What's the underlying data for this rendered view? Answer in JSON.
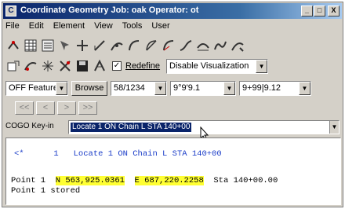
{
  "window": {
    "title": "Coordinate Geometry  Job: oak  Operator: ot",
    "app_icon": "C",
    "minimize": "_",
    "maximize": "□",
    "close": "X"
  },
  "menu": [
    "File",
    "Edit",
    "Element",
    "View",
    "Tools",
    "User"
  ],
  "toolbar": {
    "redefine_checked": "✓",
    "redefine_label": "Redefine",
    "visualization_select": "Disable Visualization"
  },
  "feature_row": {
    "feature_select": "OFF Feature",
    "browse_label": "Browse",
    "station_select": "58/1234",
    "bearing_select": "9°9'9.1",
    "value_select": "9+99|9.12"
  },
  "nav": {
    "first": "<<",
    "prev": "<",
    "next": ">",
    "last": ">>"
  },
  "keyin": {
    "label": "COGO Key-in",
    "value": "Locate 1 ON Chain L STA 140+00"
  },
  "output": {
    "command_prefix": "<*      1   ",
    "command_text": "Locate 1 ON Chain L STA 140+00",
    "point_label": "Point 1  ",
    "northing": "N 563,925.0361",
    "easting": "E 687,220.2258",
    "station": "  Sta 140+00.00",
    "stored": "Point 1 stored"
  }
}
